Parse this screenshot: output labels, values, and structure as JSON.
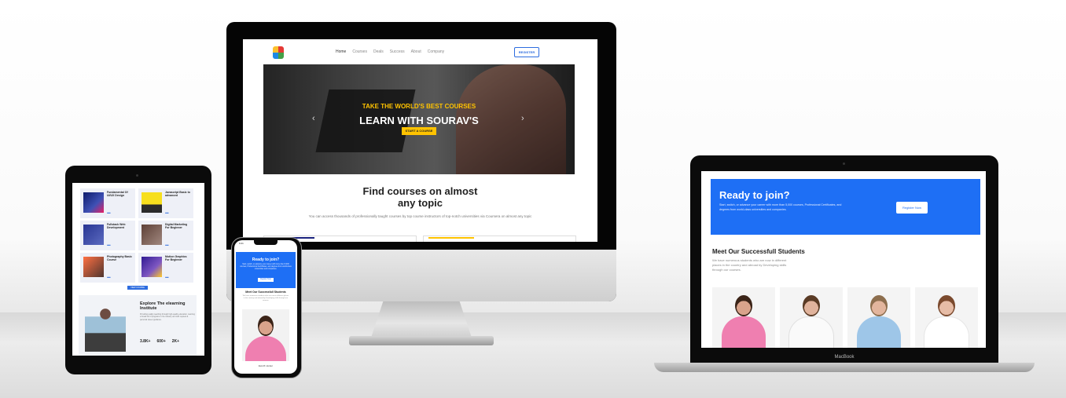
{
  "colors": {
    "brand_blue": "#1e6ff5",
    "accent_yellow": "#ffc300"
  },
  "imac": {
    "nav": {
      "items": [
        "Home",
        "Courses",
        "Deals",
        "Success",
        "About",
        "Company"
      ],
      "register": "REGISTER"
    },
    "hero": {
      "subtitle": "TAKE THE WORLD'S BEST COURSES",
      "title": "LEARN WITH SOURAV'S",
      "button": "START A COURSE",
      "prev": "‹",
      "next": "›"
    },
    "find": {
      "title_line1": "Find courses on almost",
      "title_line2": "any topic",
      "description": "You can access thousands of professionally taught courses by top course instructors of top-notch universities via Coursera on almost any topic"
    }
  },
  "ipad": {
    "courses": [
      {
        "title": "Fundamental Of UI/UX Design"
      },
      {
        "title": "Javascript Basic to advanced"
      },
      {
        "title": "Fullstack Web Development"
      },
      {
        "title": "Digital Marketing For Beginner"
      },
      {
        "title": "Photography Basic Course"
      },
      {
        "title": "Motion Graphics For Beginner"
      }
    ],
    "view_more": "VIEW COURSE",
    "explore_title": "Explore The elearning Institute",
    "explore_text": "Providing quality teaching through high-quality education, learning a broad list of programs in the industry and with reputed & personal career guidance.",
    "stats": [
      "3.8K+",
      "600+",
      "2K+"
    ]
  },
  "phone": {
    "time": "9:41",
    "ready_title": "Ready to join?",
    "ready_text": "Start, switch, or advance your career with more than 5,000 courses, Professional Certificates, and degrees from world-class universities and companies.",
    "register": "Register Now",
    "meet_title": "Meet Our Successfull Students",
    "meet_text": "We have numerous students who are now in different places in the country and abroad by Developing skills through our courses.",
    "student_name": "Eva M. Hunter"
  },
  "macbook": {
    "label": "MacBook",
    "ready_title": "Ready to join?",
    "ready_text": "Start, switch, or advance your career with more than 5,000 courses, Professional Certificates, and degrees from world-class universities and companies.",
    "register": "Register Now",
    "meet_title": "Meet Our Successfull Students",
    "meet_text": "We have numerous students who are now in different places in the country and abroad by Developing skills through our courses."
  }
}
